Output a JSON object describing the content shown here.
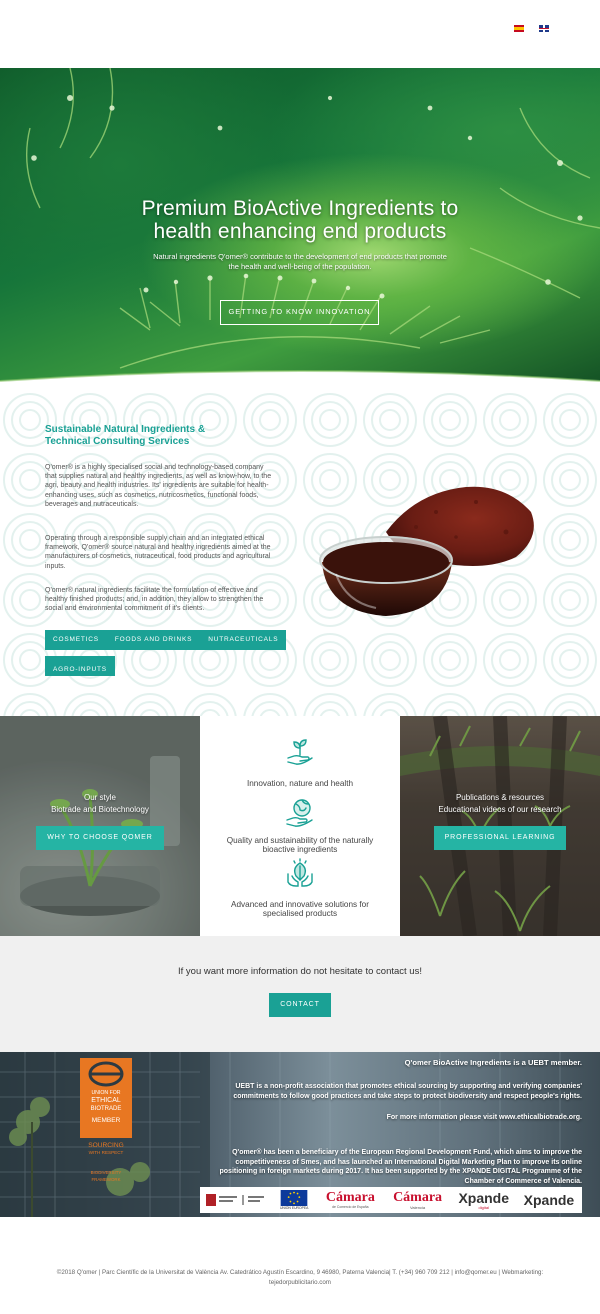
{
  "header": {
    "languages": [
      {
        "code": "es",
        "label": "Español"
      },
      {
        "code": "en",
        "label": "English"
      }
    ]
  },
  "hero": {
    "title_line1": "Premium BioActive Ingredients to",
    "title_line2": "health enhancing end products",
    "subtitle": "Natural ingredients Q'omer® contribute to the development of end products that promote the health and well-being of the population.",
    "button": "GETTING TO KNOW INNOVATION"
  },
  "intro": {
    "heading_line1": "Sustainable Natural Ingredients &",
    "heading_line2": "Technical Consulting Services",
    "paragraphs": [
      "Q'omer® is a highly specialised social and technology-based company that supplies natural and healthy ingredients, as well as know-how, to the agri, beauty and health industries. Its' ingredients are suitable for health-enhancing uses, such as cosmetics, nutricosmetics, functional foods, beverages and nutraceuticals.",
      "Operating through a responsible supply chain and an integrated ethical framework, Q'omer® source natural and healthy ingredients aimed at the manufacturers of  cosmetics, nutraceutical, food products and agricultural inputs.",
      "Q'omer® natural ingredients facilitate the formulation of effective and healthy finished products; and, in addition, they allow to strengthen the social and environmental commitment of it's clients."
    ],
    "tags": [
      "COSMETICS",
      "FOODS AND DRINKS",
      "NUTRACEUTICALS",
      "AGRO-INPUTS"
    ]
  },
  "columns": {
    "left": {
      "line1": "Our style",
      "line2": "Biotrade and Biotechnology",
      "button": "WHY TO CHOOSE QOMER"
    },
    "middle": {
      "features": [
        {
          "icon": "hand-plant-icon",
          "text": "Innovation, nature and health"
        },
        {
          "icon": "hand-globe-icon",
          "text": "Quality and sustainability of the naturally bioactive ingredients"
        },
        {
          "icon": "hands-leaf-icon",
          "text": "Advanced and innovative solutions for specialised products"
        }
      ]
    },
    "right": {
      "line1": "Publications & resources",
      "line2": "Educational videos of our research",
      "button": "PROFESSIONAL LEARNING"
    }
  },
  "contact": {
    "text": "If you want more information do not hesitate to contact us!",
    "button": "CONTACT"
  },
  "uebt": {
    "badge": {
      "line1": "UNION FOR",
      "line2": "ETHICAL",
      "line3": "BIOTRADE",
      "line4": "MEMBER",
      "line5": "SOURCING",
      "line6": "WITH RESPECT",
      "line7": "BIODIVERSITY",
      "line8": "FRAMEWORK"
    },
    "p1": "Q'omer BioActive Ingredients is a UEBT member.",
    "p2": "UEBT is a non-profit association that promotes ethical sourcing by supporting and verifying companies' commitments to follow good practices and take steps to protect biodiversity and respect people's rights.",
    "p3": "For more information please visit www.ethicalbiotrade.org.",
    "p4": "Q'omer® has been a beneficiary of the European Regional Development Fund, which aims to improve the competitiveness of Smes, and has launched an International Digital Marketing Plan to improve its online positioning in foreign markets during 2017. It has been supported by the XPANDE DIGITAL Programme of the Chamber of Commerce of Valencia.",
    "logos": {
      "eu": "UNIÓN EUROPEA",
      "camara1": "Cámara",
      "camara1_sub": "de Comercio de España",
      "camara2": "Cámara",
      "camara2_sub": "Valencia",
      "xpande1": "Xpande",
      "xpande1_sub": "digital",
      "xpande2": "Xpande"
    }
  },
  "footer": {
    "text": "©2018 Q'omer | Parc Científic de la Universitat de València Av. Catedrático Agustín Escardino, 9 46980, Paterna Valencia| T. (+34) 960 709 212 | info@qomer.eu  | Webmarketing: tejedorpublicitario.com"
  },
  "colors": {
    "teal": "#1aa195",
    "teal_light": "#25b4a4",
    "uebt_orange": "#e87722"
  }
}
